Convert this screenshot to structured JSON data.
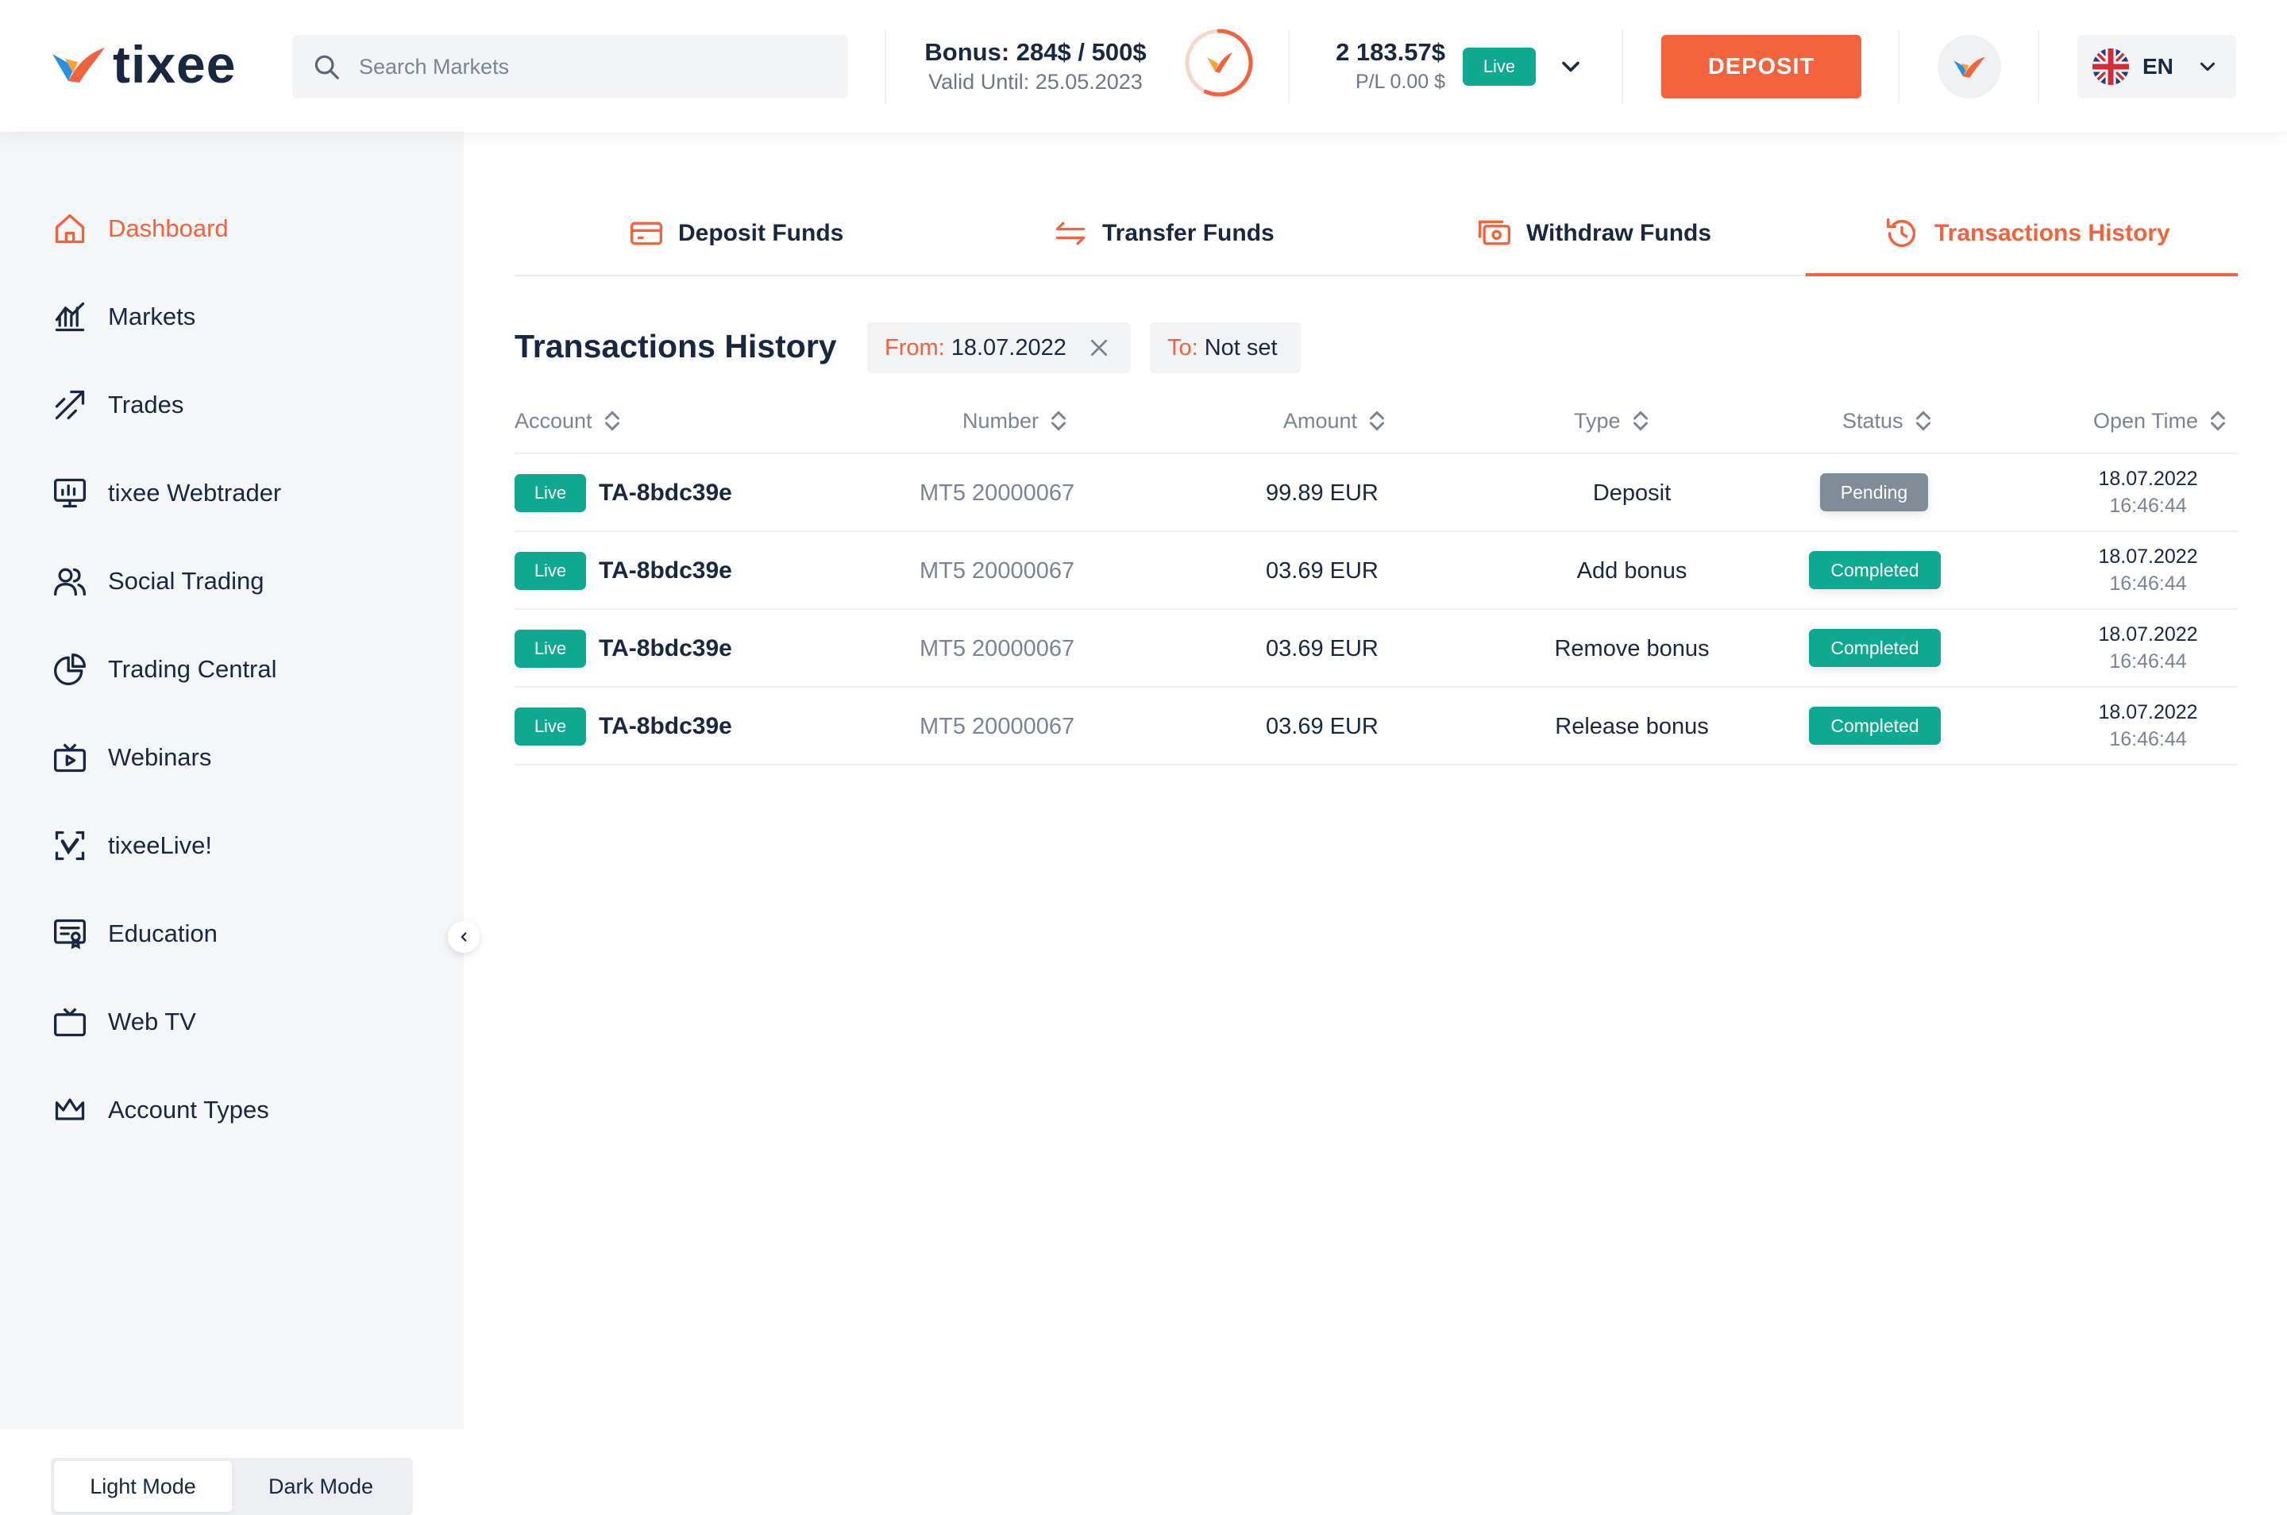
{
  "brand": {
    "name": "tixee",
    "accent": "#f2623c",
    "live_color": "#0fa891",
    "logo_blue": "#2a8fe0"
  },
  "header": {
    "search_placeholder": "Search Markets",
    "bonus_main": "Bonus: 284$ / 500$",
    "bonus_valid": "Valid Until: 25.05.2023",
    "bonus_progress": 0.568,
    "balance_main": "2 183.57$",
    "balance_pl": "P/L 0.00 $",
    "account_mode": "Live",
    "deposit_label": "DEPOSIT",
    "language": "EN"
  },
  "sidebar": {
    "items": [
      {
        "label": "Dashboard",
        "icon": "home-icon"
      },
      {
        "label": "Markets",
        "icon": "markets-chart-icon"
      },
      {
        "label": "Trades",
        "icon": "trades-arrows-icon"
      },
      {
        "label": "tixee Webtrader",
        "icon": "monitor-chart-icon"
      },
      {
        "label": "Social Trading",
        "icon": "users-icon"
      },
      {
        "label": "Trading Central",
        "icon": "pie-chart-icon"
      },
      {
        "label": "Webinars",
        "icon": "webinar-icon"
      },
      {
        "label": "tixeeLive!",
        "icon": "live-scan-icon"
      },
      {
        "label": "Education",
        "icon": "certificate-icon"
      },
      {
        "label": "Web TV",
        "icon": "tv-icon"
      },
      {
        "label": "Account Types",
        "icon": "crown-icon"
      }
    ],
    "light_mode": "Light Mode",
    "dark_mode": "Dark Mode"
  },
  "tabs": [
    {
      "label": "Deposit Funds",
      "icon": "card-icon"
    },
    {
      "label": "Transfer Funds",
      "icon": "transfer-icon"
    },
    {
      "label": "Withdraw Funds",
      "icon": "cash-icon"
    },
    {
      "label": "Transactions History",
      "icon": "history-icon"
    }
  ],
  "history": {
    "title": "Transactions History",
    "from_key": "From:",
    "from_value": "18.07.2022",
    "to_key": "To:",
    "to_value": "Not set",
    "columns": [
      "Account",
      "Number",
      "Amount",
      "Type",
      "Status",
      "Open Time"
    ],
    "rows": [
      {
        "mode": "Live",
        "account": "TA-8bdc39e",
        "number": "MT5 20000067",
        "amount": "99.89 EUR",
        "type": "Deposit",
        "status": "Pending",
        "date": "18.07.2022",
        "time": "16:46:44"
      },
      {
        "mode": "Live",
        "account": "TA-8bdc39e",
        "number": "MT5 20000067",
        "amount": "03.69 EUR",
        "type": "Add bonus",
        "status": "Completed",
        "date": "18.07.2022",
        "time": "16:46:44"
      },
      {
        "mode": "Live",
        "account": "TA-8bdc39e",
        "number": "MT5 20000067",
        "amount": "03.69 EUR",
        "type": "Remove bonus",
        "status": "Completed",
        "date": "18.07.2022",
        "time": "16:46:44"
      },
      {
        "mode": "Live",
        "account": "TA-8bdc39e",
        "number": "MT5 20000067",
        "amount": "03.69 EUR",
        "type": "Release bonus",
        "status": "Completed",
        "date": "18.07.2022",
        "time": "16:46:44"
      }
    ]
  }
}
